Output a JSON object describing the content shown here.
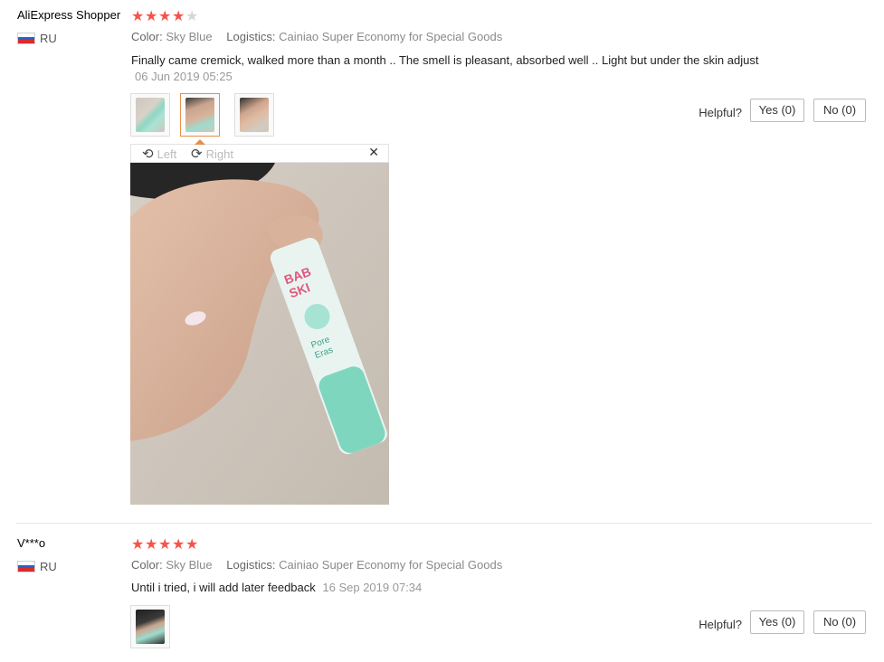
{
  "reviews": [
    {
      "user": "AliExpress Shopper",
      "country": "RU",
      "rating": 4,
      "color_label": "Color:",
      "color_value": "Sky Blue",
      "logistics_label": "Logistics:",
      "logistics_value": "Cainiao Super Economy for Special Goods",
      "text": "Finally came cremick, walked more than a month .. The smell is pleasant, absorbed well .. Light but under the skin adjust",
      "date": "06 Jun 2019 05:25",
      "helpful_label": "Helpful?",
      "yes_label": "Yes (0)",
      "no_label": "No (0)"
    },
    {
      "user": "V***o",
      "country": "RU",
      "rating": 5,
      "color_label": "Color:",
      "color_value": "Sky Blue",
      "logistics_label": "Logistics:",
      "logistics_value": "Cainiao Super Economy for Special Goods",
      "text": "Until i tried, i will add later feedback",
      "date": "16 Sep 2019 07:34",
      "helpful_label": "Helpful?",
      "yes_label": "Yes (0)",
      "no_label": "No (0)"
    }
  ],
  "viewer": {
    "rotate_left_label": "Left",
    "rotate_right_label": "Right",
    "rotate_left_icon": "rotate-left-icon",
    "rotate_right_icon": "rotate-right-icon",
    "close_icon": "close-icon"
  },
  "colors": {
    "star_on": "#f5544b",
    "star_off": "#d6d6d6",
    "thumb_active_border": "#e58f4c"
  }
}
